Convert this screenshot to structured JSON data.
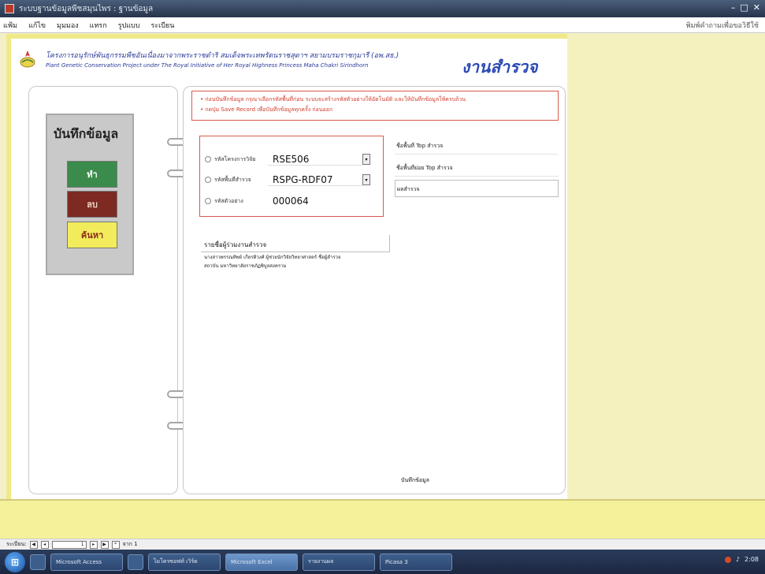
{
  "window": {
    "title": "ระบบฐานข้อมูลพืชสมุนไพร : ฐานข้อมูล"
  },
  "menubar": {
    "items": [
      "แฟ้ม",
      "แก้ไข",
      "มุมมอง",
      "แทรก",
      "รูปแบบ",
      "ระเบียน"
    ],
    "right_label": "พิมพ์คำถามเพื่อขอวิธีใช้"
  },
  "header": {
    "line1": "โครงการอนุรักษ์พันธุกรรมพืชอันเนื่องมาจากพระราชดำริ สมเด็จพระเทพรัตนราชสุดาฯ สยามบรมราชกุมารี (อพ.สธ.)",
    "line2": "Plant Genetic Conservation Project under The Royal Initiative of Her Royal Highness Princess Maha Chakri Sirindhorn",
    "title": "งานสำรวจ"
  },
  "side_menu": {
    "heading": "บันทึกข้อมูล",
    "add_label": "ทำ",
    "delete_label": "ลบ",
    "search_label": "ค้นหา"
  },
  "note": {
    "line1": "• ก่อนบันทึกข้อมูล กรุณาเลือกรหัสพื้นที่ก่อน ระบบจะสร้างรหัสตัวอย่างให้อัตโนมัติ และให้บันทึกข้อมูลให้ครบถ้วน",
    "line2": "• กดปุ่ม Save Record เพื่อบันทึกข้อมูลทุกครั้ง ก่อนออก"
  },
  "fields": [
    {
      "label": "รหัสโครงการวิจัย",
      "value": "RSE506"
    },
    {
      "label": "รหัสพื้นที่สำรวจ",
      "value": "RSPG-RDF07"
    },
    {
      "label": "รหัสตัวอย่าง",
      "value": "000064"
    }
  ],
  "info": {
    "item1": "ชื่อพื้นที่ Top สำรวจ",
    "item2": "ชื่อพื้นที่ย่อย Top สำรวจ",
    "item3": "ผลสำรวจ"
  },
  "survey": {
    "heading": "รายชื่อผู้ร่วมงานสำรวจ",
    "line1": "นางสาวพรรณทิพย์ เกียรติวงศ์ ผู้ช่วยนักวิจัยวิทยาศาสตร์ ชื่อผู้สำรวจ",
    "line2": "สถาบัน มหาวิทยาลัยราชภัฏพิบูลสงคราม"
  },
  "bottom_label": "บันทึกข้อมูล",
  "navbar": {
    "record_label": "ระเบียน:",
    "current": "1",
    "of_label": "จาก 1"
  },
  "taskbar": {
    "tasks": [
      "Microsoft Access",
      "ไมโครซอฟท์ เวิร์ด",
      "Microsoft Excel",
      "รายงานผล",
      "Picasa 3"
    ],
    "clock": "2:08"
  }
}
